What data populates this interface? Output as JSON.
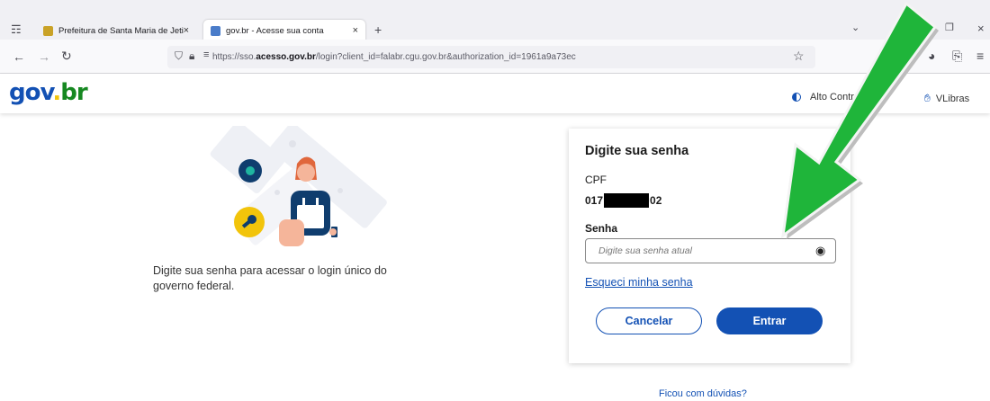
{
  "browser": {
    "tabs": [
      {
        "title": "Prefeitura de Santa Maria de Jeti",
        "favicon_color": "#c9a227"
      },
      {
        "title": "gov.br - Acesse sua conta",
        "favicon_color": "#4a7cc9"
      }
    ],
    "url": {
      "prefix": "https://sso.",
      "domain": "acesso.gov.br",
      "suffix": "/login?client_id=falabr.cgu.gov.br&authorization_id=1961a9a73ec"
    }
  },
  "header": {
    "logo_gov": "gov",
    "logo_dot": ".",
    "logo_br": "br",
    "contrast_label": "Alto Contraste",
    "vlibras_label": "VLibras",
    "colors": {
      "blue": "#1351b4",
      "yellow": "#f2c40b",
      "green": "#168821"
    }
  },
  "left_panel": {
    "description": "Digite sua senha para acessar o login único do governo federal."
  },
  "login_card": {
    "title": "Digite sua senha",
    "cpf_label": "CPF",
    "cpf_prefix": "017",
    "cpf_suffix": "02",
    "password_label": "Senha",
    "password_placeholder": "Digite sua senha atual",
    "forgot_link": "Esqueci minha senha",
    "cancel_label": "Cancelar",
    "submit_label": "Entrar",
    "primary_color": "#1351b4"
  },
  "footer": {
    "help_link": "Ficou com dúvidas?"
  },
  "overlay": {
    "arrow_color": "#1fb53a"
  }
}
